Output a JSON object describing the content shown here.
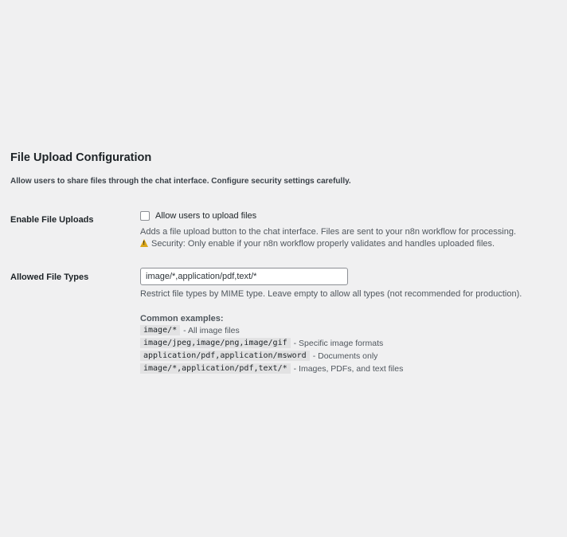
{
  "section": {
    "title": "File Upload Configuration",
    "description": "Allow users to share files through the chat interface. Configure security settings carefully."
  },
  "enable_uploads": {
    "label": "Enable File Uploads",
    "checkbox_label": "Allow users to upload files",
    "checked": false,
    "help": "Adds a file upload button to the chat interface. Files are sent to your n8n workflow for processing.",
    "warning_icon": "warning-icon",
    "warning": "Security: Only enable if your n8n workflow properly validates and handles uploaded files."
  },
  "allowed_types": {
    "label": "Allowed File Types",
    "value": "image/*,application/pdf,text/*",
    "help": "Restrict file types by MIME type. Leave empty to allow all types (not recommended for production).",
    "examples_title": "Common examples:",
    "examples": [
      {
        "code": "image/*",
        "desc": "- All image files"
      },
      {
        "code": "image/jpeg,image/png,image/gif",
        "desc": "- Specific image formats"
      },
      {
        "code": "application/pdf,application/msword",
        "desc": "- Documents only"
      },
      {
        "code": "image/*,application/pdf,text/*",
        "desc": "- Images, PDFs, and text files"
      }
    ]
  },
  "colors": {
    "background": "#f0f0f1",
    "text": "#1d2327",
    "muted": "#50575e",
    "code_bg": "#e2e2e3",
    "warning": "#dba617"
  }
}
